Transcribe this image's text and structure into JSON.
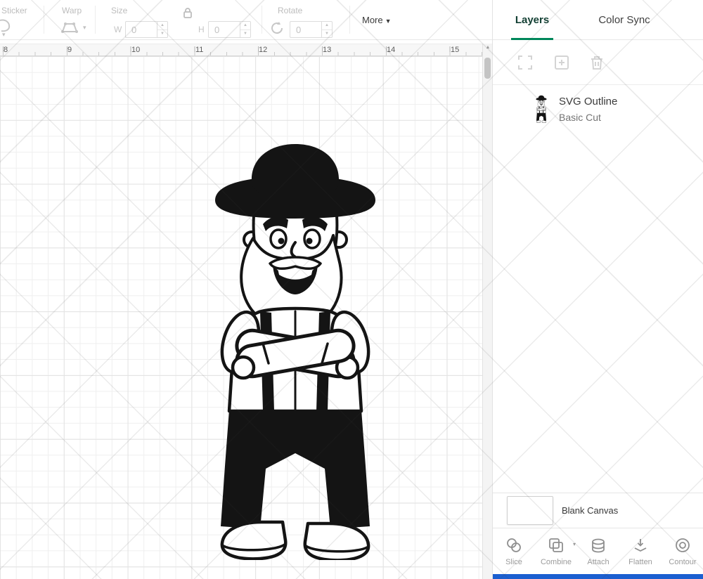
{
  "toolbar": {
    "sticker_label": "Sticker",
    "warp_label": "Warp",
    "size_label": "Size",
    "w_label": "W",
    "h_label": "H",
    "w_value": "0",
    "h_value": "0",
    "rotate_label": "Rotate",
    "rotate_value": "0",
    "more_label": "More"
  },
  "ruler": {
    "numbers": [
      "8",
      "9",
      "10",
      "11",
      "12",
      "13",
      "14",
      "15"
    ]
  },
  "panel": {
    "tabs": {
      "layers": "Layers",
      "color_sync": "Color Sync"
    },
    "layer": {
      "name": "SVG Outline",
      "cut_type": "Basic Cut"
    },
    "blank_canvas_label": "Blank Canvas",
    "actions": [
      {
        "label": "Slice"
      },
      {
        "label": "Combine"
      },
      {
        "label": "Attach"
      },
      {
        "label": "Flatten"
      },
      {
        "label": "Contour"
      }
    ]
  },
  "colors": {
    "accent_green": "#00875a",
    "bottom_bar_blue": "#1b5fd0",
    "artwork_black": "#141414"
  }
}
